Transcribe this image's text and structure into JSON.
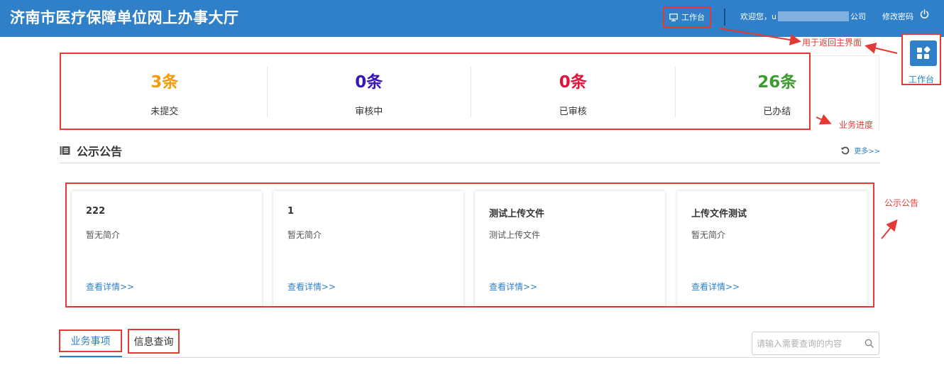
{
  "header": {
    "title": "济南市医疗保障单位网上办事大厅",
    "workbench_label": "工作台",
    "welcome_prefix": "欢迎您，",
    "welcome_initial": "u",
    "welcome_suffix": "公司",
    "change_password": "修改密码"
  },
  "stats": [
    {
      "value": "3条",
      "label": "未提交",
      "color": "#f59a0c"
    },
    {
      "value": "0条",
      "label": "审核中",
      "color": "#3a16b4"
    },
    {
      "value": "0条",
      "label": "已审核",
      "color": "#e0143c"
    },
    {
      "value": "26条",
      "label": "已办结",
      "color": "#3d9b30"
    }
  ],
  "float_workbench": {
    "label": "工作台"
  },
  "annotations": {
    "return_main": "用于返回主界面",
    "progress": "业务进度",
    "notice": "公示公告"
  },
  "notice": {
    "title": "公示公告",
    "more": "更多>>",
    "cards": [
      {
        "title": "222",
        "desc": "暂无简介",
        "link": "查看详情>>"
      },
      {
        "title": "1",
        "desc": "暂无简介",
        "link": "查看详情>>"
      },
      {
        "title": "测试上传文件",
        "desc": "测试上传文件",
        "link": "查看详情>>"
      },
      {
        "title": "上传文件测试",
        "desc": "暂无简介",
        "link": "查看详情>>"
      }
    ]
  },
  "tabs": {
    "business": "业务事项",
    "info": "信息查询"
  },
  "search": {
    "placeholder": "请输入需要查询的内容"
  },
  "colors": {
    "header_bg": "#2f80c8",
    "annotation_red": "#e53935",
    "link_blue": "#2f80c8"
  }
}
